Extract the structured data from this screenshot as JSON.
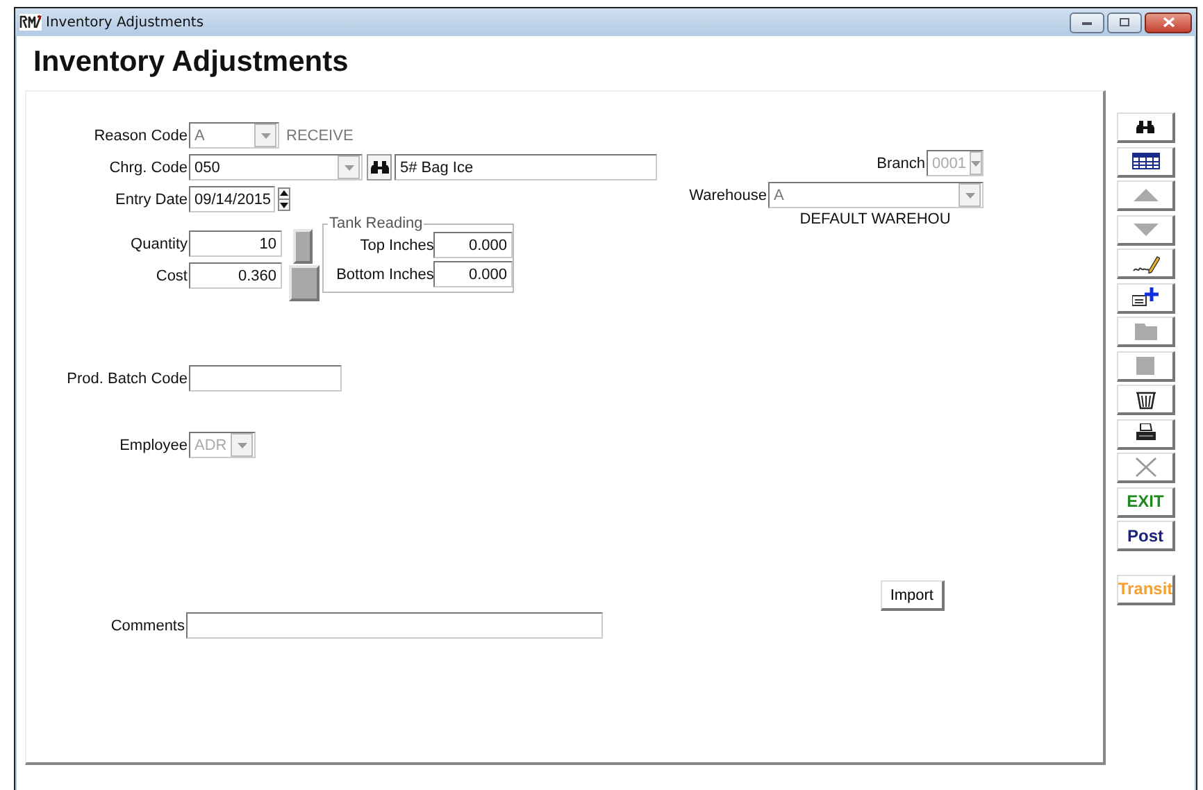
{
  "window": {
    "title": "Inventory Adjustments"
  },
  "heading": "Inventory Adjustments",
  "reason_code": {
    "label": "Reason Code",
    "value": "A",
    "description": "RECEIVE"
  },
  "charge_code": {
    "label": "Chrg. Code",
    "value": "050",
    "description": "5# Bag Ice"
  },
  "entry_date": {
    "label": "Entry Date",
    "value": "09/14/2015"
  },
  "quantity": {
    "label": "Quantity",
    "value": "10"
  },
  "cost": {
    "label": "Cost",
    "value": "0.360"
  },
  "tank_reading": {
    "title": "Tank Reading",
    "fields": [
      {
        "label": "Top Inches",
        "value": "0.000"
      },
      {
        "label": "Bottom Inches",
        "value": "0.000"
      }
    ]
  },
  "branch": {
    "label": "Branch",
    "value": "0001",
    "disabled": true
  },
  "warehouse": {
    "label": "Warehouse",
    "value": "A",
    "description": "DEFAULT WAREHOU",
    "disabled": false
  },
  "prod_batch_code": {
    "label": "Prod. Batch Code"
  },
  "employee": {
    "label": "Employee",
    "value": "ADR",
    "disabled": true
  },
  "import_button": "Import",
  "comments": {
    "label": "Comments"
  },
  "toolbar": [
    {
      "kind": "binoculars",
      "disabled": false
    },
    {
      "kind": "grid",
      "disabled": false
    },
    {
      "kind": "up",
      "disabled": true
    },
    {
      "kind": "down",
      "disabled": true
    },
    {
      "kind": "signature",
      "disabled": false
    },
    {
      "kind": "add",
      "disabled": false
    },
    {
      "kind": "folder",
      "disabled": true
    },
    {
      "kind": "square",
      "disabled": true
    },
    {
      "kind": "trash",
      "disabled": false
    },
    {
      "kind": "printer",
      "disabled": false
    },
    {
      "kind": "close",
      "disabled": true
    },
    {
      "kind": "text",
      "label": "EXIT",
      "color": "#1f8a1f",
      "disabled": false
    },
    {
      "kind": "text",
      "label": "Post",
      "color": "#1a237e",
      "disabled": false
    },
    {
      "kind": "text",
      "label": "Transit",
      "color": "#f5a030",
      "disabled": false,
      "separated": true
    }
  ]
}
